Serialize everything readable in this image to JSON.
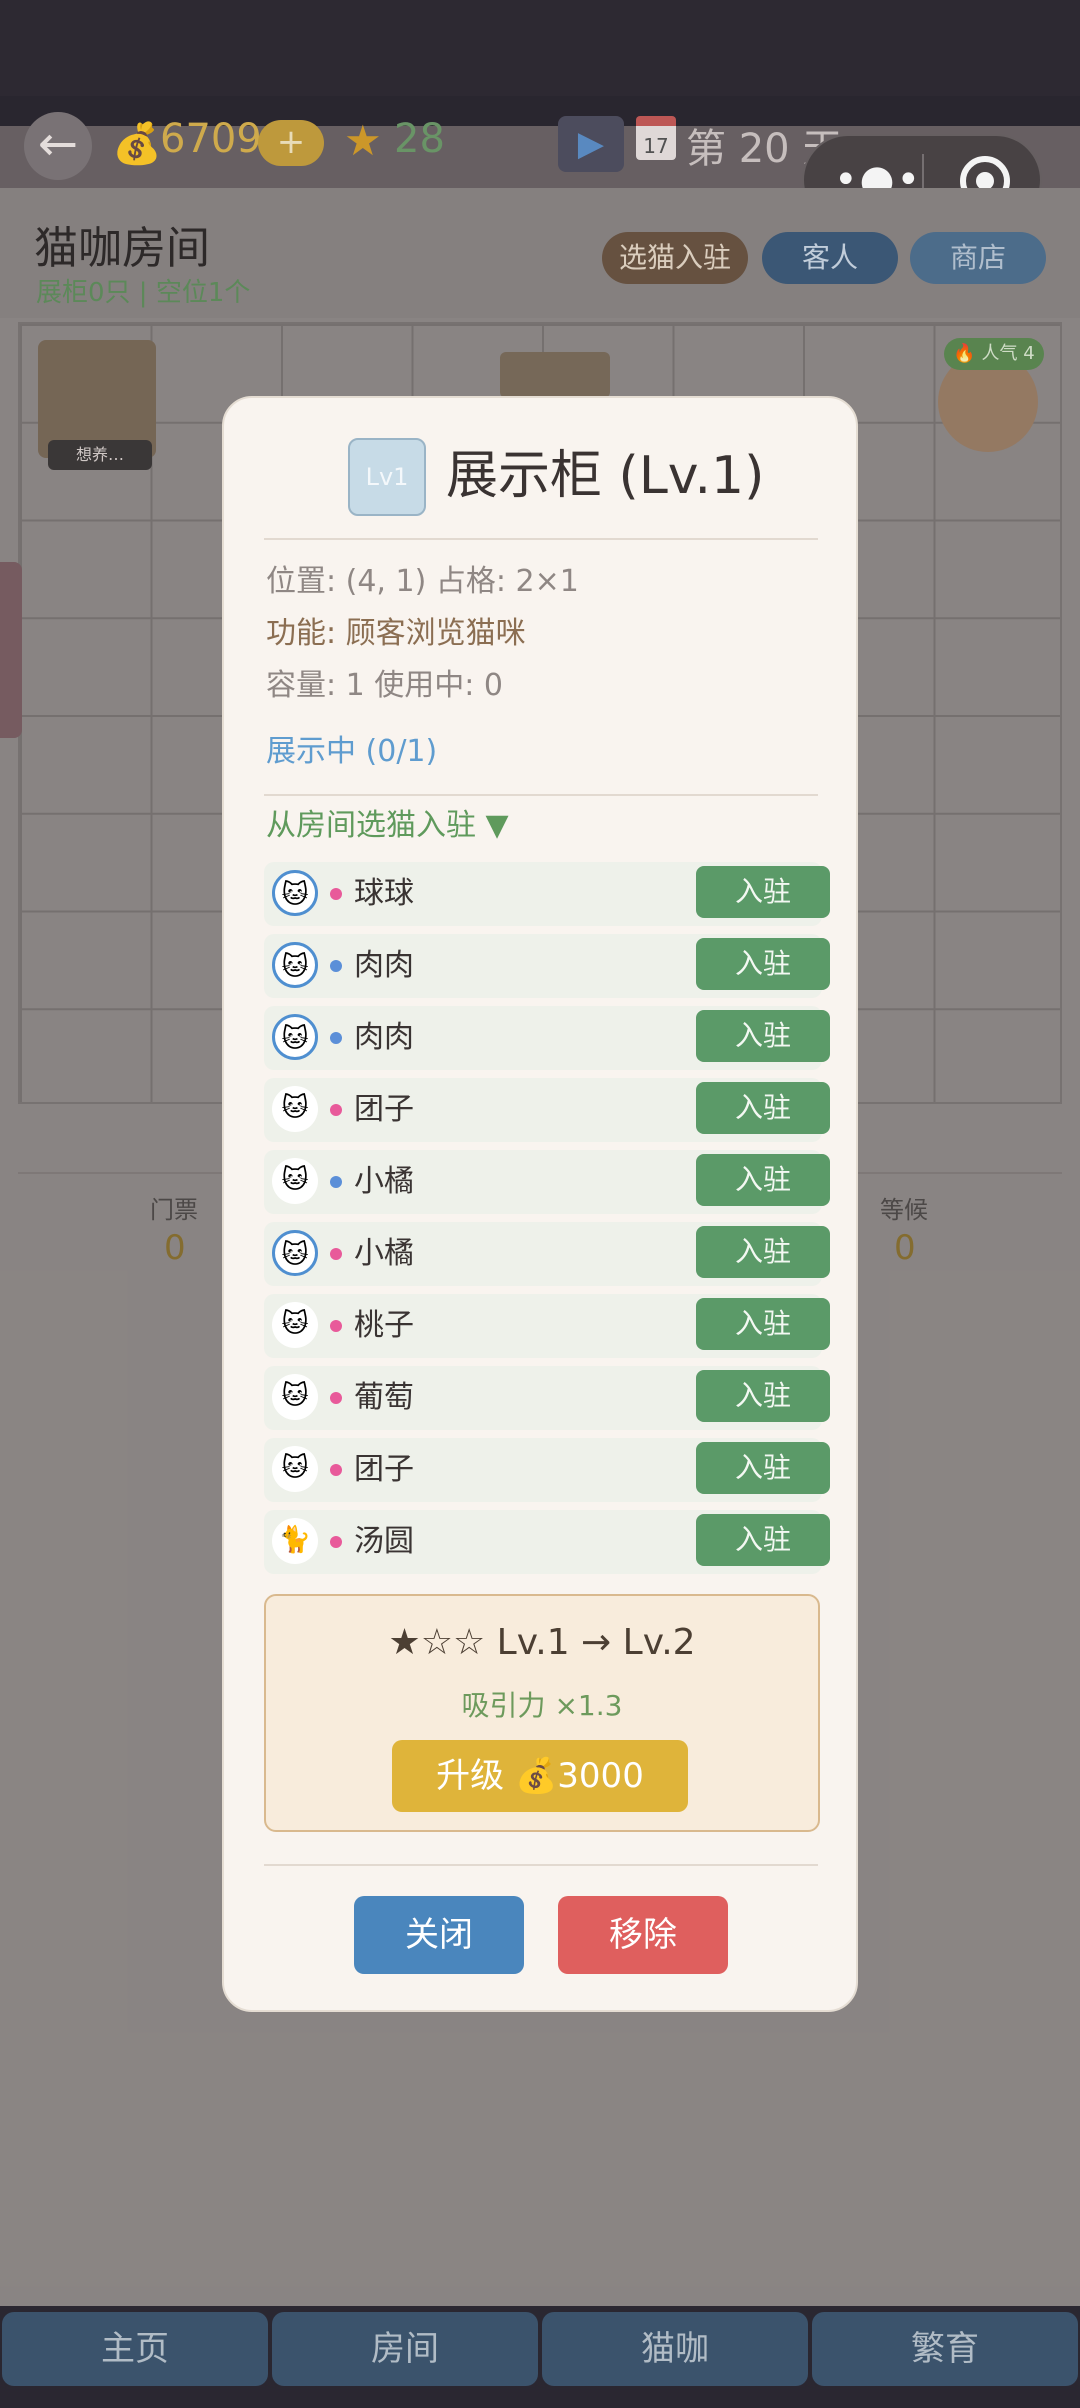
{
  "hud": {
    "back_icon": "arrow-left",
    "coins": "6709",
    "plus_label": "+",
    "stars": "28",
    "calendar_text": "17",
    "day_label": "第 20 天"
  },
  "room": {
    "title": "猫咖房间",
    "subtitle": "展柜0只 | 空位1个",
    "btn_select": "选猫入驻",
    "btn_guest": "客人",
    "btn_shop": "商店",
    "furniture_left_tag": "想养…",
    "popularity": "🔥 人气 4"
  },
  "stats": {
    "ticket_label": "门票",
    "ticket_value": "0",
    "wait_label": "等候",
    "wait_value": "0"
  },
  "modal": {
    "badge": "Lv1",
    "title": "展示柜 (Lv.1)",
    "position": "位置: (4, 1)  占格: 2×1",
    "function": "功能: 顾客浏览猫咪",
    "capacity": "容量: 1  使用中: 0",
    "showing": "展示中 (0/1)",
    "section_head": "从房间选猫入驻 ▼",
    "cats": [
      {
        "name": "球球",
        "icon": "siamese-cat",
        "glyph": "🐱",
        "gender_color": "#e85a9a",
        "ring": true,
        "action": "入驻"
      },
      {
        "name": "肉肉",
        "icon": "grey-cat",
        "glyph": "🐱",
        "gender_color": "#5b8fd8",
        "ring": true,
        "action": "入驻"
      },
      {
        "name": "肉肉",
        "icon": "grey-cat",
        "glyph": "🐱",
        "gender_color": "#5b8fd8",
        "ring": true,
        "action": "入驻"
      },
      {
        "name": "团子",
        "icon": "tabby-cat",
        "glyph": "🐱",
        "gender_color": "#e85a9a",
        "ring": false,
        "action": "入驻"
      },
      {
        "name": "小橘",
        "icon": "grey-cat",
        "glyph": "🐱",
        "gender_color": "#5b8fd8",
        "ring": false,
        "action": "入驻"
      },
      {
        "name": "小橘",
        "icon": "siamese-cat",
        "glyph": "🐱",
        "gender_color": "#e85a9a",
        "ring": true,
        "action": "入驻"
      },
      {
        "name": "桃子",
        "icon": "pink-cat",
        "glyph": "🐱",
        "gender_color": "#e85a9a",
        "ring": false,
        "action": "入驻"
      },
      {
        "name": "葡萄",
        "icon": "grey-cat",
        "glyph": "🐱",
        "gender_color": "#e85a9a",
        "ring": false,
        "action": "入驻"
      },
      {
        "name": "团子",
        "icon": "grey-cat",
        "glyph": "🐱",
        "gender_color": "#e85a9a",
        "ring": false,
        "action": "入驻"
      },
      {
        "name": "汤圆",
        "icon": "black-cat",
        "glyph": "🐈",
        "gender_color": "#e85a9a",
        "ring": false,
        "action": "入驻"
      }
    ],
    "upgrade": {
      "line": "★☆☆  Lv.1 → Lv.2",
      "attr": "吸引力 ×1.3",
      "button": "升级 💰3000"
    },
    "close_label": "关闭",
    "remove_label": "移除"
  },
  "nav": {
    "items": [
      "主页",
      "房间",
      "猫咖",
      "繁育"
    ]
  }
}
